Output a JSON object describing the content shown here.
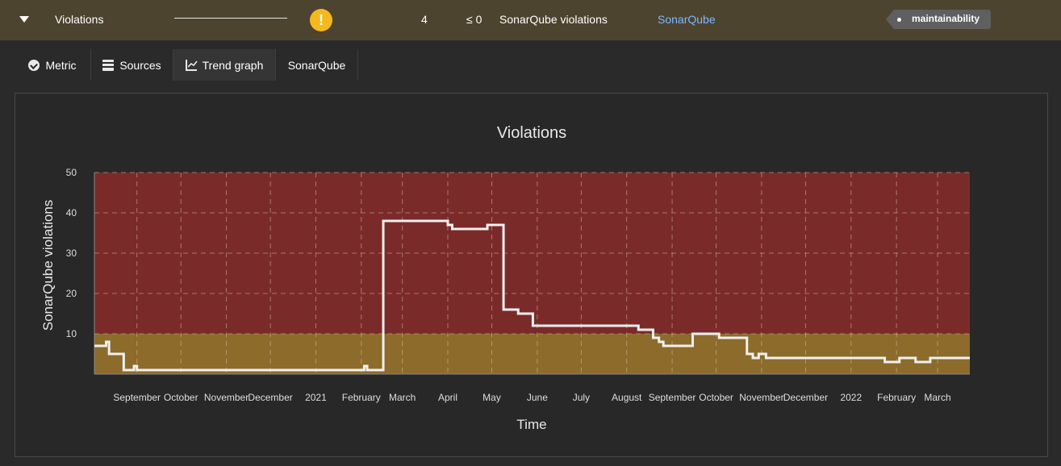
{
  "header": {
    "title": "Violations",
    "status_symbol": "!",
    "status_color": "#f5b81e",
    "value": "4",
    "target": "≤ 0",
    "unit": "SonarQube violations",
    "source_link": "SonarQube",
    "tag": "maintainability"
  },
  "tabs": [
    {
      "label": "Metric",
      "icon": "check-circle-icon"
    },
    {
      "label": "Sources",
      "icon": "database-icon"
    },
    {
      "label": "Trend graph",
      "icon": "line-chart-icon"
    },
    {
      "label": "SonarQube"
    }
  ],
  "colors": {
    "red_zone": "#7b2a2a",
    "yellow_zone": "#8c6b2b",
    "line": "#f0f0f0"
  },
  "chart_data": {
    "type": "line",
    "title": "Violations",
    "xlabel": "Time",
    "ylabel": "SonarQube violations",
    "ylim": [
      0,
      50
    ],
    "yticks": [
      10,
      20,
      30,
      40,
      50
    ],
    "xticks": [
      "September",
      "October",
      "November",
      "December",
      "2021",
      "February",
      "March",
      "April",
      "May",
      "June",
      "July",
      "August",
      "September",
      "October",
      "November",
      "December",
      "2022",
      "February",
      "March"
    ],
    "xrange": [
      "2020-08-03",
      "2022-03-23"
    ],
    "zones": [
      {
        "from": 0,
        "to": 10,
        "color": "yellow"
      },
      {
        "from": 10,
        "to": 50,
        "color": "red"
      }
    ],
    "series": [
      {
        "style": "step",
        "points": [
          [
            "2020-08-03",
            7
          ],
          [
            "2020-08-11",
            8
          ],
          [
            "2020-08-13",
            5
          ],
          [
            "2020-08-23",
            1
          ],
          [
            "2020-08-30",
            2
          ],
          [
            "2020-09-01",
            1
          ],
          [
            "2021-02-03",
            2
          ],
          [
            "2021-02-05",
            1
          ],
          [
            "2021-02-16",
            38
          ],
          [
            "2021-04-01",
            37
          ],
          [
            "2021-04-04",
            36
          ],
          [
            "2021-04-28",
            37
          ],
          [
            "2021-05-09",
            16
          ],
          [
            "2021-05-19",
            15
          ],
          [
            "2021-05-29",
            12
          ],
          [
            "2021-08-09",
            11
          ],
          [
            "2021-08-19",
            9
          ],
          [
            "2021-08-23",
            8
          ],
          [
            "2021-08-26",
            7
          ],
          [
            "2021-09-15",
            10
          ],
          [
            "2021-10-03",
            9
          ],
          [
            "2021-10-22",
            5
          ],
          [
            "2021-10-26",
            4
          ],
          [
            "2021-10-30",
            5
          ],
          [
            "2021-11-04",
            4
          ],
          [
            "2022-01-24",
            3
          ],
          [
            "2022-02-03",
            4
          ],
          [
            "2022-02-14",
            3
          ],
          [
            "2022-02-24",
            4
          ],
          [
            "2022-03-23",
            4
          ]
        ]
      }
    ]
  }
}
